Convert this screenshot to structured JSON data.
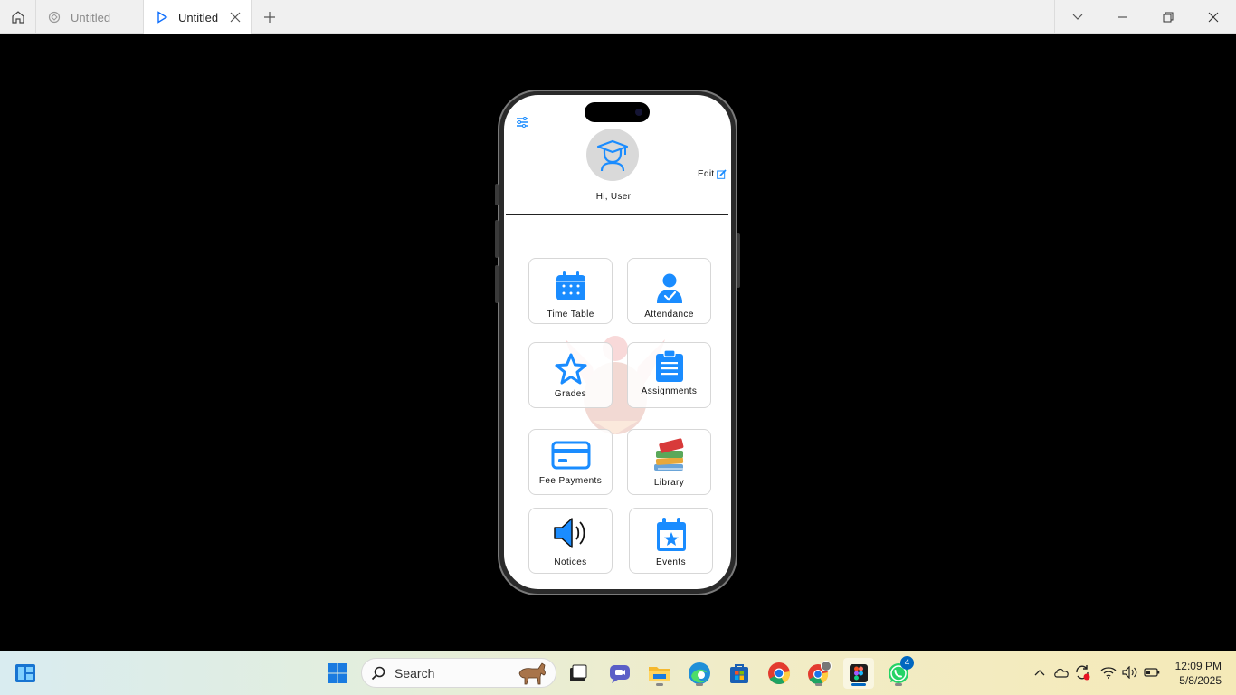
{
  "window": {
    "tabs": [
      {
        "label": "Untitled",
        "icon": "figma-logo-icon"
      },
      {
        "label": "Untitled",
        "icon": "play-icon"
      }
    ]
  },
  "app": {
    "greeting": "Hi, User",
    "edit_label": "Edit",
    "menu": [
      {
        "label": "Time Table",
        "icon": "calendar-icon"
      },
      {
        "label": "Attendance",
        "icon": "user-check-icon"
      },
      {
        "label": "Grades",
        "icon": "star-icon"
      },
      {
        "label": "Assignments",
        "icon": "clipboard-icon"
      },
      {
        "label": "Fee Payments",
        "icon": "credit-card-icon"
      },
      {
        "label": "Library",
        "icon": "books-icon"
      },
      {
        "label": "Notices",
        "icon": "speaker-icon"
      },
      {
        "label": "Events",
        "icon": "calendar-star-icon"
      }
    ],
    "accent_color": "#1a8cff"
  },
  "taskbar": {
    "search_placeholder": "Search",
    "whatsapp_badge": "4",
    "time": "12:09 PM",
    "date": "5/8/2025"
  }
}
